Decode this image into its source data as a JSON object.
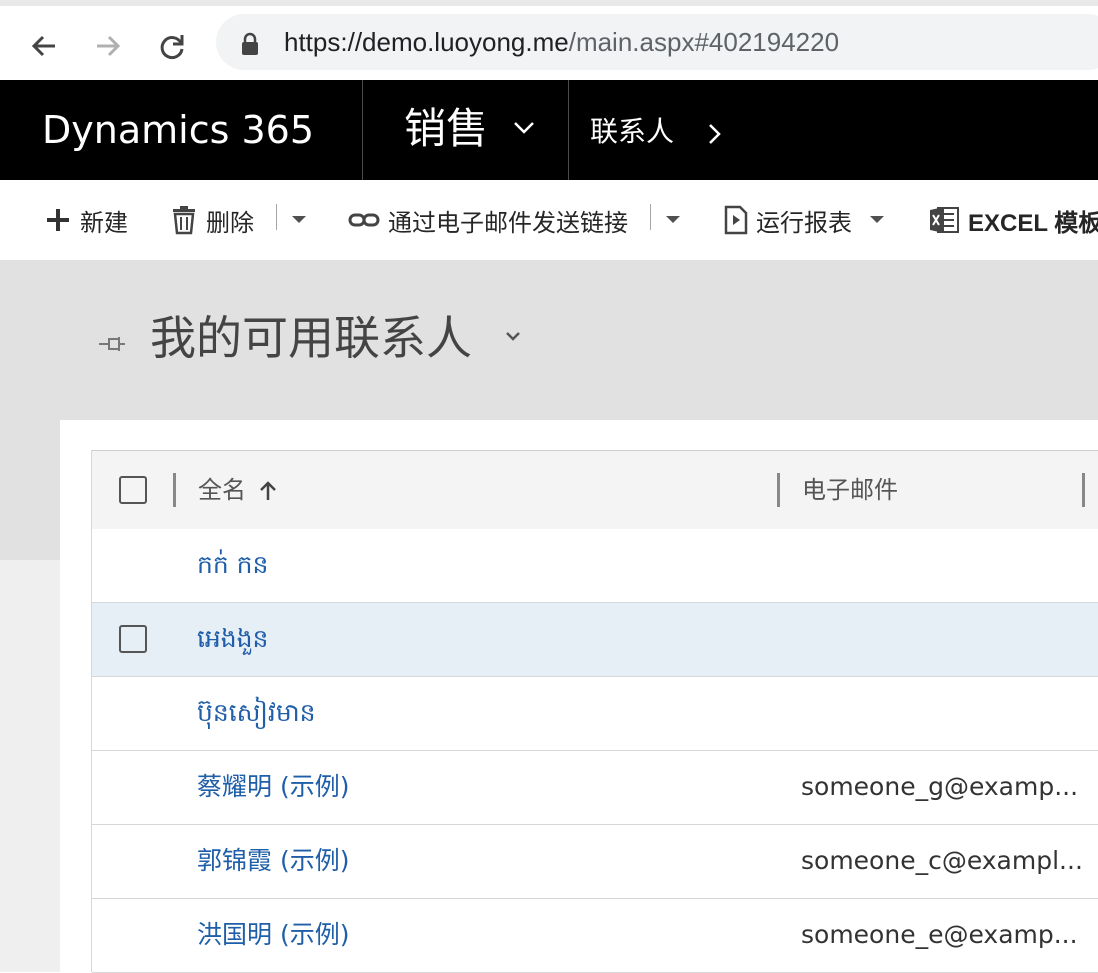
{
  "browser": {
    "url_host": "https://demo.luoyong.me",
    "url_path": "/main.aspx#402194220"
  },
  "app": {
    "brand": "Dynamics 365",
    "module": "销售",
    "breadcrumb": "联系人"
  },
  "commands": {
    "new": "新建",
    "delete": "删除",
    "email_link": "通过电子邮件发送链接",
    "run_report": "运行报表",
    "excel_templates": "EXCEL 模板"
  },
  "view": {
    "title": "我的可用联系人"
  },
  "grid": {
    "columns": [
      "全名",
      "电子邮件"
    ],
    "rows": [
      {
        "name": "កក់ កន",
        "email": ""
      },
      {
        "name": "អេងងួន",
        "email": ""
      },
      {
        "name": "ប៊ុនសៀវមាន",
        "email": ""
      },
      {
        "name": "蔡耀明 (示例)",
        "email": "someone_g@examp..."
      },
      {
        "name": "郭锦霞 (示例)",
        "email": "someone_c@exampl..."
      },
      {
        "name": "洪国明 (示例)",
        "email": "someone_e@examp..."
      }
    ]
  },
  "colors": {
    "link": "#1f5ea8",
    "appbar": "#000000",
    "row_highlight": "#e6eef6"
  }
}
